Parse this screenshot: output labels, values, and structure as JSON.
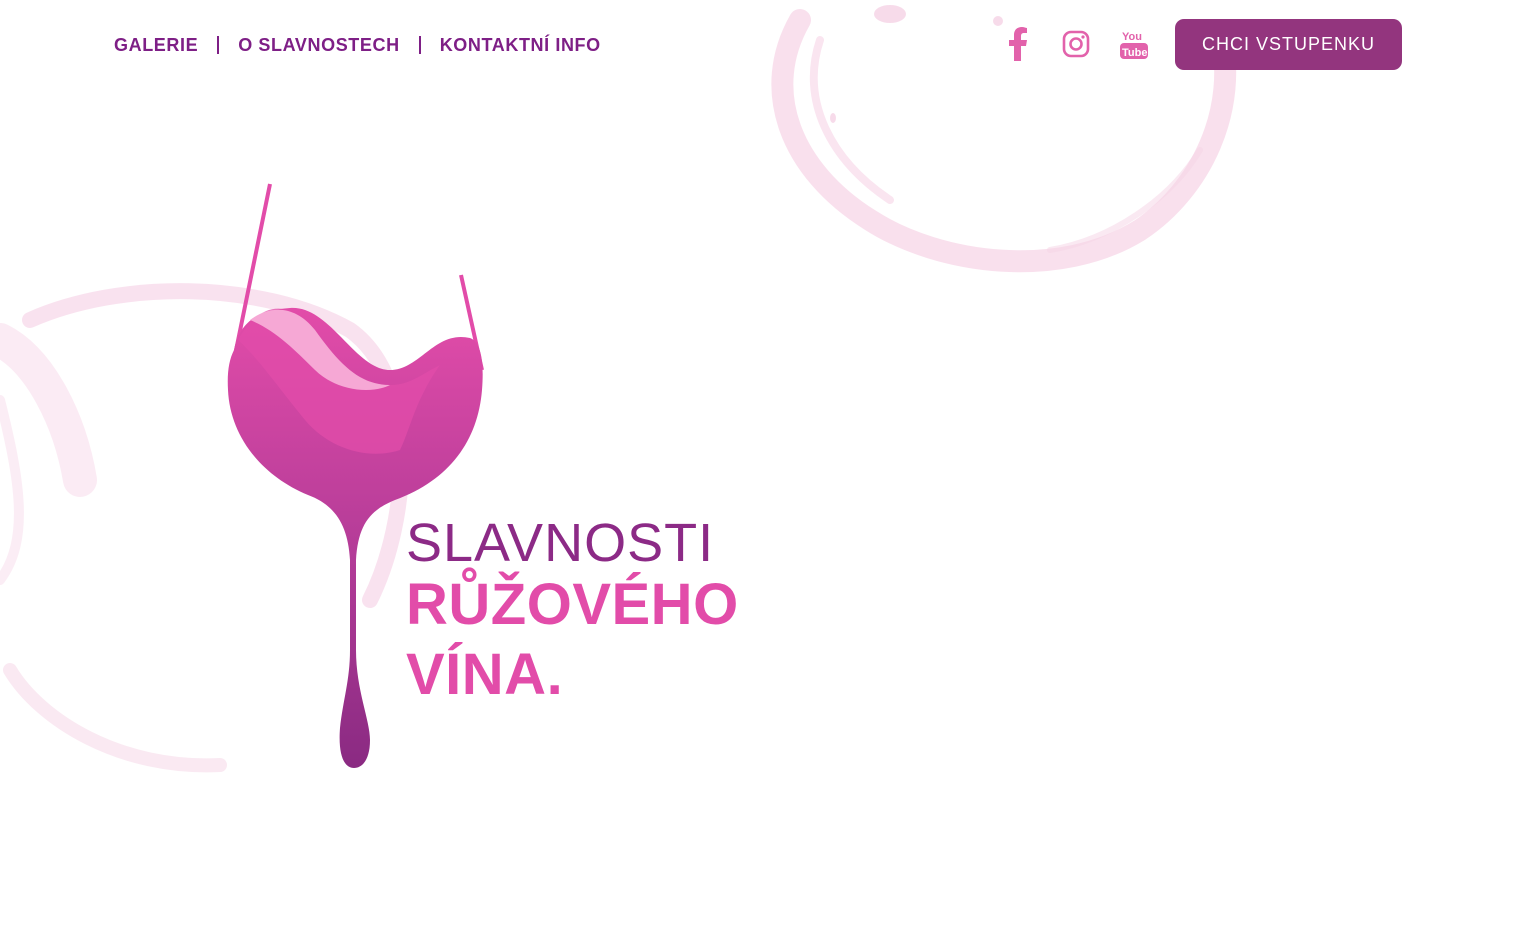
{
  "nav": {
    "items": [
      {
        "label": "GALERIE"
      },
      {
        "label": "O SLAVNOSTECH"
      },
      {
        "label": "KONTAKTNÍ INFO"
      }
    ]
  },
  "social": {
    "icons": [
      "facebook-icon",
      "instagram-icon",
      "youtube-icon"
    ],
    "youtube_logo_text": {
      "top": "You",
      "bottom": "Tube"
    }
  },
  "cta": {
    "label": "CHCI VSTUPENKU"
  },
  "hero": {
    "line1": "SLAVNOSTI",
    "line2": "RŮŽOVÉHO",
    "line3": "VÍNA."
  },
  "colors": {
    "primary_purple": "#7e1f86",
    "button": "#93357e",
    "pink": "#e24ca9",
    "stain": "#f3c6de"
  }
}
